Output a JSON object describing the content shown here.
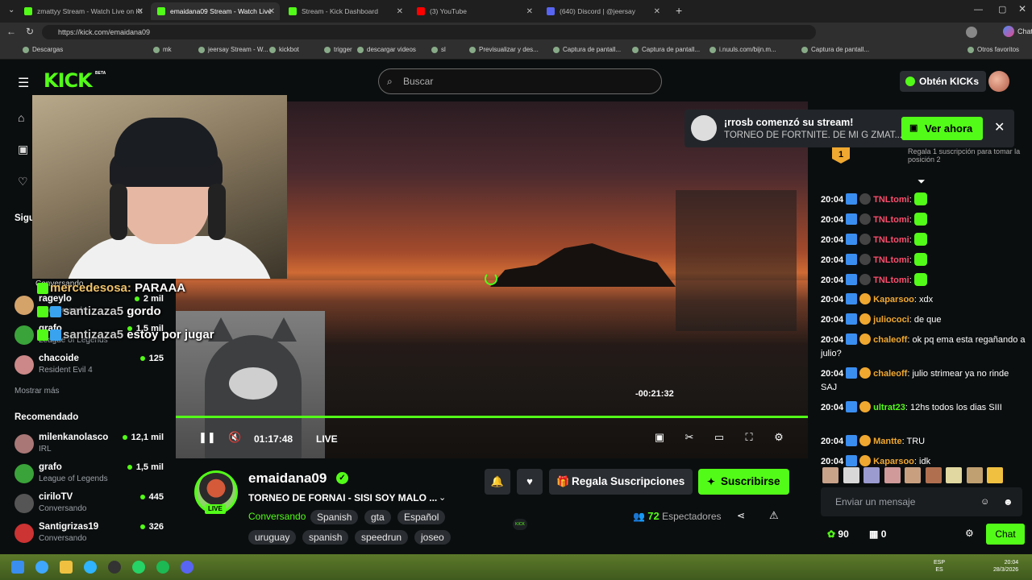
{
  "browser": {
    "tabs": [
      {
        "label": "zmattyy Stream - Watch Live on Ki",
        "color": "#53fc18",
        "active": false
      },
      {
        "label": "emaidana09 Stream - Watch Live",
        "color": "#53fc18",
        "active": true
      },
      {
        "label": "Stream - Kick Dashboard",
        "color": "#53fc18",
        "active": false
      },
      {
        "label": "(3) YouTube",
        "color": "#ff0000",
        "active": false
      },
      {
        "label": "(640) Discord | @jeersay",
        "color": "#5865f2",
        "active": false
      }
    ],
    "url": "https://kick.com/emaidana09",
    "bookmarks": [
      "Descargas",
      "mk",
      "jeersay Stream - W...",
      "kickbot",
      "trigger",
      "descargar videos",
      "sl",
      "Previsualizar y des...",
      "Captura de pantall...",
      "Captura de pantall...",
      "i.nuuls.com/bijn.m...",
      "Captura de pantall...",
      "Otros favoritos"
    ]
  },
  "header": {
    "logo": "KICK",
    "beta": "BETA",
    "search_placeholder": "Buscar",
    "get_kicks": "Obtén KICKs"
  },
  "sidebar": {
    "following_title": "Sigu",
    "following": [
      {
        "name": "rageylo",
        "category": "Conversando",
        "viewers": "2 mil",
        "color": "#d4a36a"
      },
      {
        "name": "grafo",
        "category": "League of Legends",
        "viewers": "1,5 mil",
        "color": "#3aa33a"
      },
      {
        "name": "chacoide",
        "category": "Resident Evil 4",
        "viewers": "125",
        "color": "#c88"
      }
    ],
    "show_more": "Mostrar más",
    "recommended_title": "Recomendado",
    "recommended": [
      {
        "name": "milenkanolasco",
        "category": "IRL",
        "viewers": "12,1 mil",
        "color": "#a77"
      },
      {
        "name": "grafo",
        "category": "League of Legends",
        "viewers": "1,5 mil",
        "color": "#3aa33a"
      },
      {
        "name": "ciriloTV",
        "category": "Conversando",
        "viewers": "445",
        "color": "#555"
      },
      {
        "name": "Santigrizas19",
        "category": "Conversando",
        "viewers": "326",
        "color": "#c33"
      }
    ]
  },
  "overlay": {
    "msg1_user": "mercedesosa:",
    "msg1_text": "PARAAA",
    "msg2_user": "santizaza5",
    "msg2_text": "gordo",
    "msg3_user": "santizaza5",
    "msg3_text": "estoy por jugar",
    "peek_name": "Conversando"
  },
  "player": {
    "time_tip": "-00:21:32",
    "current_time": "01:17:48",
    "live_label": "LIVE",
    "progress": 1.0
  },
  "channel": {
    "name": "emaidana09",
    "live": "LIVE",
    "title": "TORNEO DE FORNAI - SISI SOY MALO ...",
    "category": "Conversando",
    "tags": [
      "Spanish",
      "gta",
      "Español",
      "uruguay",
      "spanish",
      "speedrun",
      "joseo"
    ],
    "gift_button": "Regala Suscripciones",
    "subscribe_button": "Suscribirse",
    "viewers_count": "72",
    "viewers_label": "Espectadores"
  },
  "notification": {
    "title": "¡rrosb comenzó su stream!",
    "subtitle": "TORNEO DE FORTNITE. DE MI G ZMAT...",
    "button": "Ver ahora"
  },
  "chat": {
    "leader_rank": "1",
    "leader_hint": "Regala 1 suscripción para tomar la posición 2",
    "messages": [
      {
        "time": "20:04",
        "user": "TNLtomi",
        "text": "",
        "color": "#ff4d6d",
        "emote": true
      },
      {
        "time": "20:04",
        "user": "TNLtomi",
        "text": "",
        "color": "#ff4d6d",
        "emote": true
      },
      {
        "time": "20:04",
        "user": "TNLtomi",
        "text": "",
        "color": "#ff4d6d",
        "emote": true
      },
      {
        "time": "20:04",
        "user": "TNLtomi",
        "text": "",
        "color": "#ff4d6d",
        "emote": true
      },
      {
        "time": "20:04",
        "user": "TNLtomi",
        "text": "",
        "color": "#ff4d6d",
        "emote": true
      },
      {
        "time": "20:04",
        "user": "Kaparsoo",
        "text": "xdx",
        "color": "#f0a830",
        "emote": false
      },
      {
        "time": "20:04",
        "user": "juliococi",
        "text": "de que",
        "color": "#f0a830",
        "emote": false
      },
      {
        "time": "20:04",
        "user": "chaleoff",
        "text": "ok pq ema esta regañando a julio?",
        "color": "#f0a830",
        "emote": false
      },
      {
        "time": "20:04",
        "user": "chaleoff",
        "text": "julio strimear ya no rinde SAJ",
        "color": "#f0a830",
        "emote": false
      },
      {
        "time": "20:04",
        "user": "ultrat23",
        "text": "12hs todos los dias SIII",
        "color": "#53fc18",
        "emote": false
      },
      {
        "time": "20:04",
        "user": "Mantte",
        "text": "TRU",
        "color": "#f0a830",
        "emote": false
      },
      {
        "time": "20:04",
        "user": "Kaparsoo",
        "text": "idk",
        "color": "#f0a830",
        "emote": false
      }
    ],
    "input_placeholder": "Enviar un mensaje",
    "points": "90",
    "gifts": "0",
    "chat_button": "Chat"
  },
  "taskbar": {
    "lang1": "ESP",
    "lang2": "ES",
    "time": "20:04",
    "date": "28/3/2026"
  }
}
